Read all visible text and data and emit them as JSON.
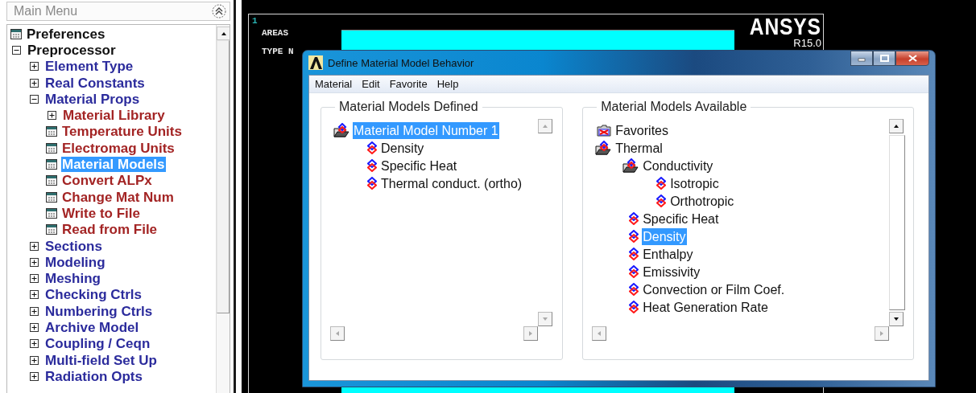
{
  "main_menu": {
    "title": "Main Menu",
    "items": [
      {
        "label": "Preferences",
        "kind": "dialog",
        "selected": false
      },
      {
        "label": "Preprocessor",
        "kind": "folder",
        "expanded": true,
        "selected": false,
        "children": [
          {
            "label": "Element Type",
            "kind": "folder",
            "expanded": false,
            "selected": false
          },
          {
            "label": "Real Constants",
            "kind": "folder",
            "expanded": false,
            "selected": false
          },
          {
            "label": "Material Props",
            "kind": "folder",
            "expanded": true,
            "selected": false,
            "children": [
              {
                "label": "Material Library",
                "kind": "folder",
                "expanded": false,
                "selected": false
              },
              {
                "label": "Temperature Units",
                "kind": "dialog",
                "selected": false
              },
              {
                "label": "Electromag Units",
                "kind": "dialog",
                "selected": false
              },
              {
                "label": "Material Models",
                "kind": "dialog",
                "selected": true
              },
              {
                "label": "Convert ALPx",
                "kind": "dialog",
                "selected": false
              },
              {
                "label": "Change Mat Num",
                "kind": "dialog",
                "selected": false
              },
              {
                "label": "Write to File",
                "kind": "dialog",
                "selected": false
              },
              {
                "label": "Read from File",
                "kind": "dialog",
                "selected": false
              }
            ]
          },
          {
            "label": "Sections",
            "kind": "folder",
            "expanded": false,
            "selected": false
          },
          {
            "label": "Modeling",
            "kind": "folder",
            "expanded": false,
            "selected": false
          },
          {
            "label": "Meshing",
            "kind": "folder",
            "expanded": false,
            "selected": false
          },
          {
            "label": "Checking Ctrls",
            "kind": "folder",
            "expanded": false,
            "selected": false
          },
          {
            "label": "Numbering Ctrls",
            "kind": "folder",
            "expanded": false,
            "selected": false
          },
          {
            "label": "Archive Model",
            "kind": "folder",
            "expanded": false,
            "selected": false
          },
          {
            "label": "Coupling / Ceqn",
            "kind": "folder",
            "expanded": false,
            "selected": false
          },
          {
            "label": "Multi-field Set Up",
            "kind": "folder",
            "expanded": false,
            "selected": false
          },
          {
            "label": "Radiation Opts",
            "kind": "folder",
            "expanded": false,
            "selected": false
          }
        ]
      }
    ]
  },
  "graphics": {
    "window_number": "1",
    "labels": [
      "AREAS",
      "TYPE N"
    ],
    "logo": "ANSYS",
    "version": "R15.0"
  },
  "dialog": {
    "title": "Define Material Model Behavior",
    "menu": [
      "Material",
      "Edit",
      "Favorite",
      "Help"
    ],
    "panels": [
      {
        "title": "Material Models Defined",
        "items": [
          {
            "label": "Material Model Number 1",
            "kind": "folder",
            "expanded": true,
            "selected": true,
            "children": [
              {
                "label": "Density",
                "kind": "model",
                "selected": false
              },
              {
                "label": "Specific Heat",
                "kind": "model",
                "selected": false
              },
              {
                "label": "Thermal conduct. (ortho)",
                "kind": "model",
                "selected": false
              }
            ]
          }
        ]
      },
      {
        "title": "Material Models Available",
        "items": [
          {
            "label": "Favorites",
            "kind": "favorites",
            "selected": false
          },
          {
            "label": "Thermal",
            "kind": "folder",
            "expanded": true,
            "selected": false,
            "children": [
              {
                "label": "Conductivity",
                "kind": "folder",
                "expanded": true,
                "selected": false,
                "children": [
                  {
                    "label": "Isotropic",
                    "kind": "model",
                    "selected": false
                  },
                  {
                    "label": "Orthotropic",
                    "kind": "model",
                    "selected": false
                  }
                ]
              },
              {
                "label": "Specific Heat",
                "kind": "model",
                "selected": false
              },
              {
                "label": "Density",
                "kind": "model",
                "selected": true
              },
              {
                "label": "Enthalpy",
                "kind": "model",
                "selected": false
              },
              {
                "label": "Emissivity",
                "kind": "model",
                "selected": false
              },
              {
                "label": "Convection or Film Coef.",
                "kind": "model",
                "selected": false
              },
              {
                "label": "Heat Generation Rate",
                "kind": "model",
                "selected": false
              }
            ]
          }
        ]
      }
    ]
  }
}
